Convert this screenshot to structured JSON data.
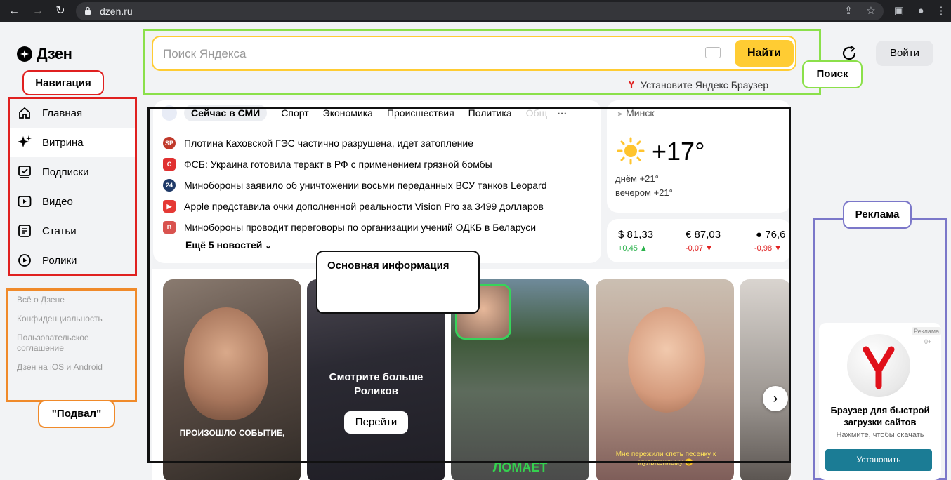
{
  "browser": {
    "url": "dzen.ru"
  },
  "logo": {
    "text": "Дзен"
  },
  "callouts": {
    "navigation": "Навигация",
    "search": "Поиск",
    "main": "Основная информация",
    "ads": "Реклама",
    "footer": "\"Подвал\""
  },
  "colors": {
    "search_accent": "#ffcc33",
    "nav_frame": "#e02020",
    "search_frame": "#8be04a",
    "main_frame": "#111111",
    "ads_frame": "#7b77c9",
    "footer_frame": "#f08a2a"
  },
  "sidebar": {
    "items": [
      {
        "label": "Главная",
        "icon": "home-icon"
      },
      {
        "label": "Витрина",
        "icon": "sparkle-icon"
      },
      {
        "label": "Подписки",
        "icon": "subscriptions-icon"
      },
      {
        "label": "Видео",
        "icon": "video-icon"
      },
      {
        "label": "Статьи",
        "icon": "articles-icon"
      },
      {
        "label": "Ролики",
        "icon": "shorts-icon"
      }
    ],
    "active_index": 1
  },
  "footer": {
    "links": [
      "Всё о Дзене",
      "Конфиденциальность",
      "Пользовательское соглашение",
      "Дзен на iOS и Android"
    ]
  },
  "search": {
    "placeholder": "Поиск Яндекса",
    "button": "Найти",
    "install": "Установите Яндекс Браузер"
  },
  "header": {
    "login": "Войти"
  },
  "news": {
    "tabs": [
      "Сейчас в СМИ",
      "Спорт",
      "Экономика",
      "Происшествия",
      "Политика",
      "Общ"
    ],
    "items": [
      {
        "text": "Плотина Каховской ГЭС частично разрушена, идет затопление",
        "source": "SP",
        "color": "#c0392b"
      },
      {
        "text": "ФСБ: Украина готовила теракт в РФ с применением грязной бомбы",
        "source": "C",
        "color": "#e03030"
      },
      {
        "text": "Минобороны заявило об уничтожении восьми переданных ВСУ танков Leopard",
        "source": "24",
        "color": "#1f3a68"
      },
      {
        "text": "Apple представила очки дополненной реальности Vision Pro за 3499 долларов",
        "source": "▶",
        "color": "#e53935"
      },
      {
        "text": "Минобороны проводит переговоры по организации учений ОДКБ в Беларуси",
        "source": "B",
        "color": "#d9534f"
      }
    ],
    "more": "Ещё 5 новостей"
  },
  "weather": {
    "city": "Минск",
    "temp": "+17°",
    "day": "днём +21°",
    "evening": "вечером +21°"
  },
  "rates": [
    {
      "value": "$ 81,33",
      "delta": "+0,45 ▲",
      "dir": "up"
    },
    {
      "value": "€ 87,03",
      "delta": "-0,07 ▼",
      "dir": "down"
    },
    {
      "value": "76,6",
      "delta": "-0,98 ▼",
      "dir": "down"
    }
  ],
  "videos": {
    "cards": [
      {
        "caption": "ПРОИЗОШЛО СОБЫТИЕ,"
      },
      {
        "title": "Смотрите больше Роликов",
        "button": "Перейти"
      },
      {
        "caption": "ЛОМАЕТ"
      },
      {
        "caption": "Мне пережили спеть песенку к мультфильму 😊"
      },
      {
        "caption": ""
      }
    ]
  },
  "ad": {
    "badge": "Реклама",
    "age": "0+",
    "title": "Браузер для быстрой загрузки сайтов",
    "subtitle": "Нажмите, чтобы скачать",
    "button": "Установить"
  }
}
